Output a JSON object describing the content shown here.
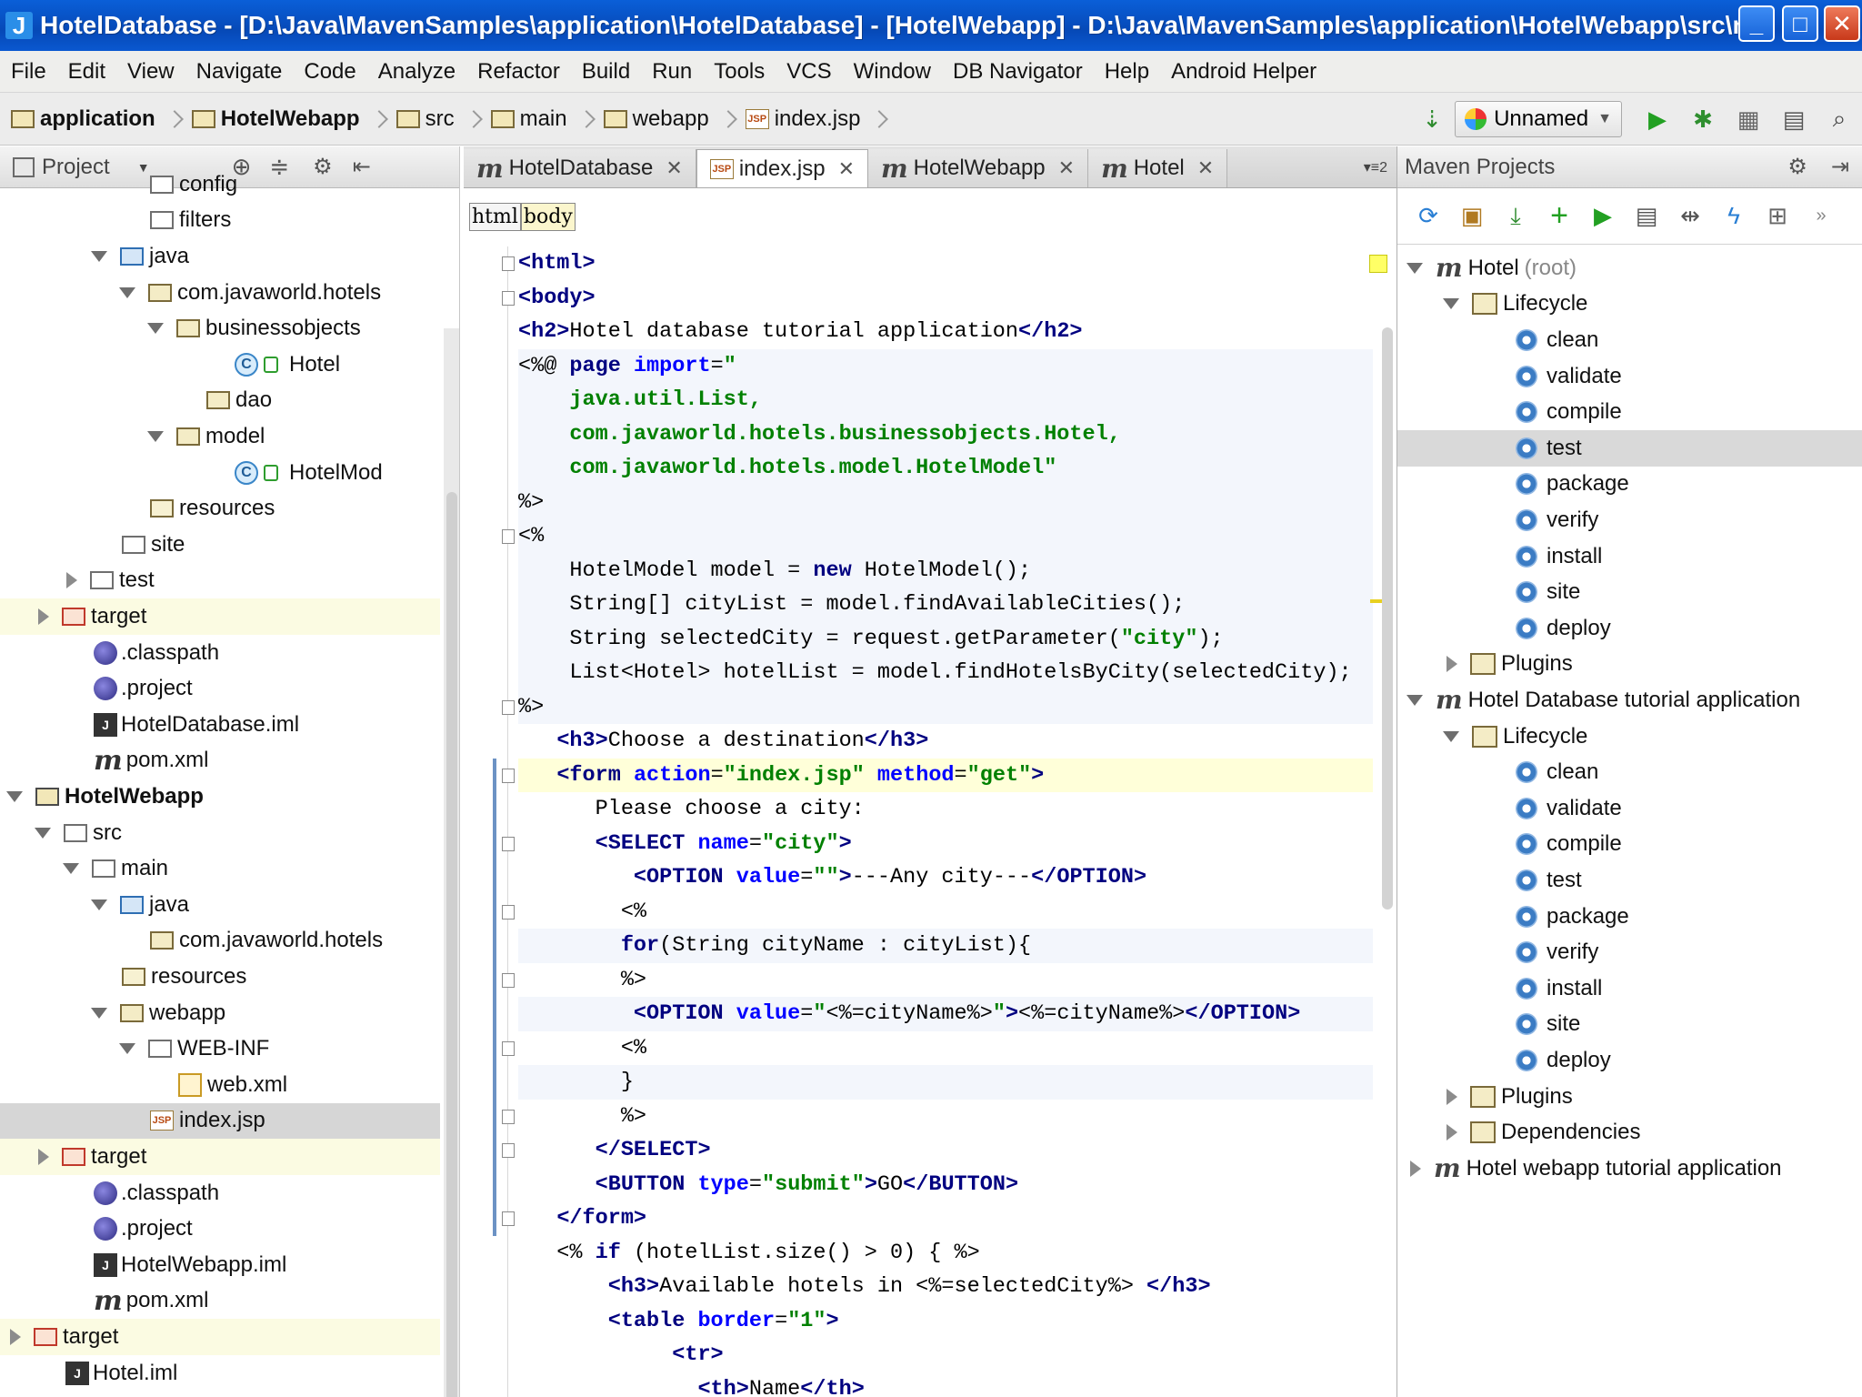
{
  "window": {
    "title": "HotelDatabase - [D:\\Java\\MavenSamples\\application\\HotelDatabase] - [HotelWebapp] - D:\\Java\\MavenSamples\\application\\HotelWebapp\\src\\main\\w...",
    "min": "_",
    "max": "□",
    "close": "✕"
  },
  "menu": [
    "File",
    "Edit",
    "View",
    "Navigate",
    "Code",
    "Analyze",
    "Refactor",
    "Build",
    "Run",
    "Tools",
    "VCS",
    "Window",
    "DB Navigator",
    "Help",
    "Android Helper"
  ],
  "breadcrumbs": [
    "application",
    "HotelWebapp",
    "src",
    "main",
    "webapp",
    "index.jsp"
  ],
  "run_config": "Unnamed",
  "project_panel": {
    "title": "Project",
    "rows": [
      {
        "label": "config",
        "depth": 5,
        "icon": "folder",
        "arrow": "none",
        "cls": ""
      },
      {
        "label": "filters",
        "depth": 5,
        "icon": "folder",
        "arrow": "none",
        "cls": ""
      },
      {
        "label": "java",
        "depth": 4,
        "icon": "folder-blue",
        "arrow": "down",
        "cls": ""
      },
      {
        "label": "com.javaworld.hotels",
        "depth": 5,
        "icon": "folder-pkg",
        "arrow": "down",
        "cls": ""
      },
      {
        "label": "businessobjects",
        "depth": 6,
        "icon": "folder-pkg",
        "arrow": "down",
        "cls": ""
      },
      {
        "label": "Hotel",
        "depth": 8,
        "icon": "class",
        "arrow": "none",
        "cls": ""
      },
      {
        "label": "dao",
        "depth": 7,
        "icon": "folder-pkg",
        "arrow": "none",
        "cls": ""
      },
      {
        "label": "model",
        "depth": 6,
        "icon": "folder-pkg",
        "arrow": "down",
        "cls": ""
      },
      {
        "label": "HotelMod",
        "depth": 8,
        "icon": "class",
        "arrow": "none",
        "cls": ""
      },
      {
        "label": "resources",
        "depth": 5,
        "icon": "folder-res",
        "arrow": "none",
        "cls": ""
      },
      {
        "label": "site",
        "depth": 4,
        "icon": "folder",
        "arrow": "none",
        "cls": ""
      },
      {
        "label": "test",
        "depth": 3,
        "icon": "folder",
        "arrow": "right",
        "cls": ""
      },
      {
        "label": "target",
        "depth": 2,
        "icon": "folder-red",
        "arrow": "right",
        "cls": "hl-yellow"
      },
      {
        "label": ".classpath",
        "depth": 3,
        "icon": "eclipse",
        "arrow": "none",
        "cls": ""
      },
      {
        "label": ".project",
        "depth": 3,
        "icon": "eclipse",
        "arrow": "none",
        "cls": ""
      },
      {
        "label": "HotelDatabase.iml",
        "depth": 3,
        "icon": "iml",
        "arrow": "none",
        "cls": ""
      },
      {
        "label": "pom.xml",
        "depth": 3,
        "icon": "maven",
        "arrow": "none",
        "cls": ""
      },
      {
        "label": "HotelWebapp",
        "depth": 1,
        "icon": "folder-proj",
        "arrow": "down",
        "cls": "bold"
      },
      {
        "label": "src",
        "depth": 2,
        "icon": "folder",
        "arrow": "down",
        "cls": ""
      },
      {
        "label": "main",
        "depth": 3,
        "icon": "folder",
        "arrow": "down",
        "cls": ""
      },
      {
        "label": "java",
        "depth": 4,
        "icon": "folder-blue",
        "arrow": "down",
        "cls": ""
      },
      {
        "label": "com.javaworld.hotels",
        "depth": 5,
        "icon": "folder-pkg",
        "arrow": "none",
        "cls": ""
      },
      {
        "label": "resources",
        "depth": 4,
        "icon": "folder-res",
        "arrow": "none",
        "cls": ""
      },
      {
        "label": "webapp",
        "depth": 4,
        "icon": "folder-pkg",
        "arrow": "down",
        "cls": ""
      },
      {
        "label": "WEB-INF",
        "depth": 5,
        "icon": "folder",
        "arrow": "down",
        "cls": ""
      },
      {
        "label": "web.xml",
        "depth": 6,
        "icon": "xml",
        "arrow": "none",
        "cls": ""
      },
      {
        "label": "index.jsp",
        "depth": 5,
        "icon": "jsp",
        "arrow": "none",
        "cls": "selected"
      },
      {
        "label": "target",
        "depth": 2,
        "icon": "folder-red",
        "arrow": "right",
        "cls": "hl-yellow"
      },
      {
        "label": ".classpath",
        "depth": 3,
        "icon": "eclipse",
        "arrow": "none",
        "cls": ""
      },
      {
        "label": ".project",
        "depth": 3,
        "icon": "eclipse",
        "arrow": "none",
        "cls": ""
      },
      {
        "label": "HotelWebapp.iml",
        "depth": 3,
        "icon": "iml",
        "arrow": "none",
        "cls": ""
      },
      {
        "label": "pom.xml",
        "depth": 3,
        "icon": "maven",
        "arrow": "none",
        "cls": ""
      },
      {
        "label": "target",
        "depth": 1,
        "icon": "folder-red",
        "arrow": "right",
        "cls": "hl-yellow"
      },
      {
        "label": "Hotel.iml",
        "depth": 2,
        "icon": "iml",
        "arrow": "none",
        "cls": ""
      }
    ]
  },
  "editor": {
    "tabs": [
      {
        "label": "HotelDatabase",
        "icon": "maven",
        "active": false
      },
      {
        "label": "index.jsp",
        "icon": "jsp",
        "active": true
      },
      {
        "label": "HotelWebapp",
        "icon": "maven",
        "active": false
      },
      {
        "label": "Hotel",
        "icon": "maven",
        "active": false
      }
    ],
    "tabs_overflow": "▾≡2",
    "html_breadcrumb": [
      "html",
      "body"
    ],
    "code_lines": [
      "<span class='tag'>&lt;html&gt;</span>",
      "<span class='tag'>&lt;body&gt;</span>",
      "<span class='tag'>&lt;h2&gt;</span>Hotel database tutorial application<span class='tag'>&lt;/h2&gt;</span>",
      "&lt;%@ <span class='kw'>page</span> <span class='attr'>import</span>=<span class='val'>\"</span>",
      "    <span class='val'>java.util.List,</span>",
      "    <span class='val'>com.javaworld.hotels.businessobjects.Hotel,</span>",
      "    <span class='val'>com.javaworld.hotels.model.HotelModel</span><span class='val'>\"</span>",
      "%&gt;",
      "&lt;%",
      "    HotelModel model = <span class='jkw'>new</span> HotelModel();",
      "    String[] cityList = model.findAvailableCities();",
      "    String selectedCity = request.getParameter(<span class='str'>\"city\"</span>);",
      "    List&lt;Hotel&gt; hotelList = model.findHotelsByCity(selectedCity);",
      "%&gt;",
      "   <span class='tag'>&lt;h3&gt;</span>Choose a destination<span class='tag'>&lt;/h3&gt;</span>",
      "   <span class='tag'>&lt;form</span> <span class='attr'>action</span>=<span class='val'>\"index.jsp\"</span> <span class='attr'>method</span>=<span class='val'>\"get\"</span><span class='tag'>&gt;</span>",
      "      Please choose a city:",
      "      <span class='tag'>&lt;SELECT</span> <span class='attr'>name</span>=<span class='val'>\"city\"</span><span class='tag'>&gt;</span>",
      "         <span class='tag'>&lt;OPTION</span> <span class='attr'>value</span>=<span class='val'>\"\"</span><span class='tag'>&gt;</span>---Any city---<span class='tag'>&lt;/OPTION&gt;</span>",
      "        &lt;%",
      "        <span class='jkw'>for</span>(String cityName : cityList){",
      "        %&gt;",
      "         <span class='tag'>&lt;OPTION</span> <span class='attr'>value</span>=<span class='val'>\"</span>&lt;%=cityName%&gt;<span class='val'>\"</span><span class='tag'>&gt;</span>&lt;%=cityName%&gt;<span class='tag'>&lt;/OPTION&gt;</span>",
      "        &lt;%",
      "        }",
      "        %&gt;",
      "      <span class='tag'>&lt;/SELECT&gt;</span>",
      "      <span class='tag'>&lt;BUTTON</span> <span class='attr'>type</span>=<span class='val'>\"submit\"</span><span class='tag'>&gt;</span>GO<span class='tag'>&lt;/BUTTON&gt;</span>",
      "   <span class='tag'>&lt;/form&gt;</span>",
      "   &lt;% <span class='jkw'>if</span> (hotelList.size() &gt; 0) { %&gt;",
      "       <span class='tag'>&lt;h3&gt;</span>Available hotels in &lt;%=selectedCity%&gt; <span class='tag'>&lt;/h3&gt;</span>",
      "       <span class='tag'>&lt;table</span> <span class='attr'>border</span>=<span class='val'>\"1\"</span><span class='tag'>&gt;</span>",
      "            <span class='tag'>&lt;tr&gt;</span>",
      "              <span class='tag'>&lt;th&gt;</span>Name<span class='tag'>&lt;/th&gt;</span>"
    ]
  },
  "maven_panel": {
    "title": "Maven Projects",
    "rows": [
      {
        "label": "Hotel",
        "extra": "(root)",
        "depth": 0,
        "icon": "module",
        "arrow": "down",
        "cls": ""
      },
      {
        "label": "Lifecycle",
        "extra": "",
        "depth": 1,
        "icon": "lifecycle",
        "arrow": "down",
        "cls": ""
      },
      {
        "label": "clean",
        "extra": "",
        "depth": 3,
        "icon": "gear",
        "arrow": "none",
        "cls": ""
      },
      {
        "label": "validate",
        "extra": "",
        "depth": 3,
        "icon": "gear",
        "arrow": "none",
        "cls": ""
      },
      {
        "label": "compile",
        "extra": "",
        "depth": 3,
        "icon": "gear",
        "arrow": "none",
        "cls": ""
      },
      {
        "label": "test",
        "extra": "",
        "depth": 3,
        "icon": "gear",
        "arrow": "none",
        "cls": "selected"
      },
      {
        "label": "package",
        "extra": "",
        "depth": 3,
        "icon": "gear",
        "arrow": "none",
        "cls": ""
      },
      {
        "label": "verify",
        "extra": "",
        "depth": 3,
        "icon": "gear",
        "arrow": "none",
        "cls": ""
      },
      {
        "label": "install",
        "extra": "",
        "depth": 3,
        "icon": "gear",
        "arrow": "none",
        "cls": ""
      },
      {
        "label": "site",
        "extra": "",
        "depth": 3,
        "icon": "gear",
        "arrow": "none",
        "cls": ""
      },
      {
        "label": "deploy",
        "extra": "",
        "depth": 3,
        "icon": "gear",
        "arrow": "none",
        "cls": ""
      },
      {
        "label": "Plugins",
        "extra": "",
        "depth": 1,
        "icon": "lifecycle",
        "arrow": "right",
        "cls": ""
      },
      {
        "label": "Hotel Database tutorial application",
        "extra": "",
        "depth": 0,
        "icon": "module",
        "arrow": "down",
        "cls": ""
      },
      {
        "label": "Lifecycle",
        "extra": "",
        "depth": 1,
        "icon": "lifecycle",
        "arrow": "down",
        "cls": ""
      },
      {
        "label": "clean",
        "extra": "",
        "depth": 3,
        "icon": "gear",
        "arrow": "none",
        "cls": ""
      },
      {
        "label": "validate",
        "extra": "",
        "depth": 3,
        "icon": "gear",
        "arrow": "none",
        "cls": ""
      },
      {
        "label": "compile",
        "extra": "",
        "depth": 3,
        "icon": "gear",
        "arrow": "none",
        "cls": ""
      },
      {
        "label": "test",
        "extra": "",
        "depth": 3,
        "icon": "gear",
        "arrow": "none",
        "cls": ""
      },
      {
        "label": "package",
        "extra": "",
        "depth": 3,
        "icon": "gear",
        "arrow": "none",
        "cls": ""
      },
      {
        "label": "verify",
        "extra": "",
        "depth": 3,
        "icon": "gear",
        "arrow": "none",
        "cls": ""
      },
      {
        "label": "install",
        "extra": "",
        "depth": 3,
        "icon": "gear",
        "arrow": "none",
        "cls": ""
      },
      {
        "label": "site",
        "extra": "",
        "depth": 3,
        "icon": "gear",
        "arrow": "none",
        "cls": ""
      },
      {
        "label": "deploy",
        "extra": "",
        "depth": 3,
        "icon": "gear",
        "arrow": "none",
        "cls": ""
      },
      {
        "label": "Plugins",
        "extra": "",
        "depth": 1,
        "icon": "lifecycle",
        "arrow": "right",
        "cls": ""
      },
      {
        "label": "Dependencies",
        "extra": "",
        "depth": 1,
        "icon": "lifecycle",
        "arrow": "right",
        "cls": ""
      },
      {
        "label": "Hotel webapp tutorial application",
        "extra": "",
        "depth": 0,
        "icon": "module",
        "arrow": "right",
        "cls": ""
      }
    ]
  }
}
